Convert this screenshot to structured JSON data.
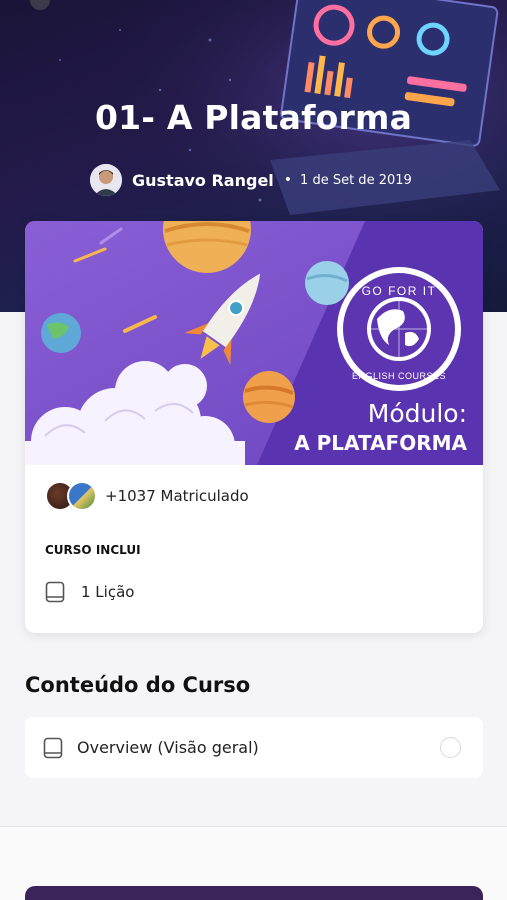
{
  "hero": {
    "title": "01- A Plataforma",
    "author_name": "Gustavo Rangel",
    "separator": "•",
    "date": "1 de Set de 2019"
  },
  "card": {
    "banner": {
      "logo_top_text": "GO FOR IT",
      "logo_bottom_text": "ENGLISH COURSES",
      "label": "Módulo:",
      "title": "A PLATAFORMA"
    },
    "enrolled_text": "+1037 Matriculado",
    "includes_heading": "CURSO INCLUI",
    "lessons_text": "1 Lição"
  },
  "content": {
    "section_title": "Conteúdo do Curso",
    "items": [
      {
        "label": "Overview (Visão geral)",
        "icon": "book-icon",
        "completed": false
      }
    ]
  },
  "colors": {
    "banner_purple": "#7b52c9",
    "banner_dark_purple": "#5e35b1",
    "cta": "#3b2459",
    "hero_bg": "#1a1438"
  }
}
